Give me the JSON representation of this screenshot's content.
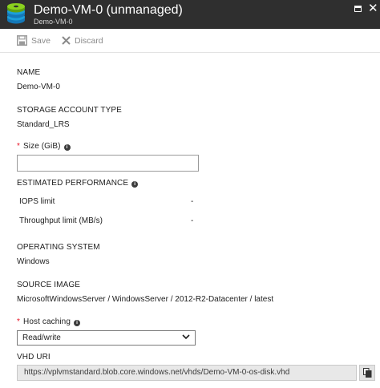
{
  "window": {
    "title": "Demo-VM-0 (unmanaged)",
    "subtitle": "Demo-VM-0",
    "icon": "disk-stack-icon"
  },
  "toolbar": {
    "save_label": "Save",
    "discard_label": "Discard"
  },
  "fields": {
    "name_label": "NAME",
    "name_value": "Demo-VM-0",
    "storage_label": "STORAGE ACCOUNT TYPE",
    "storage_value": "Standard_LRS",
    "size_label": "Size (GiB)",
    "size_value": "",
    "perf_label": "ESTIMATED PERFORMANCE",
    "iops_label": "IOPS limit",
    "iops_value": "-",
    "throughput_label": "Throughput limit (MB/s)",
    "throughput_value": "-",
    "os_label": "OPERATING SYSTEM",
    "os_value": "Windows",
    "source_label": "SOURCE IMAGE",
    "source_value": "MicrosoftWindowsServer / WindowsServer / 2012-R2-Datacenter / latest",
    "caching_label": "Host caching",
    "caching_value": "Read/write",
    "vhd_label": "VHD URI",
    "vhd_value": "https://vplvmstandard.blob.core.windows.net/vhds/Demo-VM-0-os-disk.vhd"
  },
  "required_mark": "*",
  "info_glyph": "i",
  "colors": {
    "titlebar": "#2f2f2f",
    "required": "#e81123",
    "disk_top": "#8bd11f",
    "disk_blue": "#1c9fd8"
  }
}
